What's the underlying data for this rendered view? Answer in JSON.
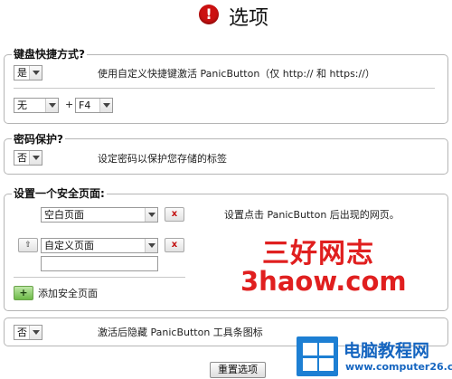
{
  "header": {
    "icon_glyph": "!",
    "title": "选项"
  },
  "hotkey": {
    "title": "键盘快捷方式?",
    "enable_select": "是",
    "enable_description": "使用自定义快捷键激活 PanicButton（仅 http:// 和 https://）",
    "modifier_select": "无",
    "plus": "+",
    "key_select": "F4"
  },
  "password": {
    "title": "密码保护?",
    "enable_select": "否",
    "description": "设定密码以保护您存储的标签"
  },
  "safe_page": {
    "title": "设置一个安全页面:",
    "description": "设置点击 PanicButton 后出现的网页。",
    "row1_select": "空白页面",
    "row2_select": "自定义页面",
    "remove_glyph": "x",
    "up_glyph": "⇧",
    "add_glyph": "+",
    "add_label": "添加安全页面"
  },
  "toolbar_icon": {
    "enable_select": "否",
    "description": "激活后隐藏 PanicButton 工具条图标"
  },
  "reset_label": "重置选项",
  "watermark": {
    "site_cn": "三好网志",
    "site_en": "3haow.com",
    "logo_name": "电脑教程网",
    "logo_url": "www.computer26.com"
  },
  "colors": {
    "accent_red": "#e01f1f",
    "logo_blue": "#1d7fd3",
    "add_green": "#6cba47"
  }
}
